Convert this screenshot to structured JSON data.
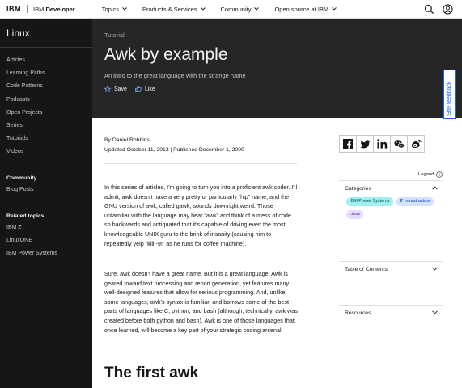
{
  "topnav": {
    "logo": "IBM",
    "brand_prefix": "IBM",
    "brand_name": "Developer",
    "items": [
      {
        "label": "Topics"
      },
      {
        "label": "Products & Services"
      },
      {
        "label": "Community"
      },
      {
        "label": "Open source at IBM"
      }
    ],
    "icons": [
      "search-icon",
      "user-icon"
    ]
  },
  "sidebar": {
    "title": "Linux",
    "items": [
      {
        "label": "Articles"
      },
      {
        "label": "Learning Paths"
      },
      {
        "label": "Code Patterns"
      },
      {
        "label": "Podcasts"
      },
      {
        "label": "Open Projects"
      },
      {
        "label": "Series"
      },
      {
        "label": "Tutorials"
      },
      {
        "label": "Videos"
      }
    ],
    "community_heading": "Community",
    "community_link": "Blog Posts",
    "related_heading": "Related topics",
    "related": [
      {
        "label": "IBM Z"
      },
      {
        "label": "LinuxONE"
      },
      {
        "label": "IBM Power Systems"
      }
    ]
  },
  "hero": {
    "kicker": "Tutorial",
    "title": "Awk by example",
    "subtitle": "An intro to the great language with the strange name",
    "save_label": "Save",
    "like_label": "Like"
  },
  "feedback_label": "Site feedback",
  "article": {
    "author": "By Daniel Robbins",
    "dates": "Updated October 11, 2013 | Published December 1, 2000",
    "para1": "In this series of articles, I’m going to turn you into a proficient awk coder. I’ll admit, awk doesn’t have a very pretty or particularly “hip” name, and the GNU version of awk, called gawk, sounds downright weird. Those unfamiliar with the language may hear “awk” and think of a mess of code so backwards and antiquated that it’s capable of driving even the most knowledgeable UNIX guru to the brink of insanity (causing him to repeatedly yelp “kill -9!” as he runs for coffee machine).",
    "para2": "Sure, awk doesn’t have a great name. But it is a great language. Awk is geared toward text processing and report generation, yet features many well-designed features that allow for serious programming. And, unlike some languages, awk’s syntax is familiar, and borrows some of the best parts of languages like C, python, and bash (although, technically, awk was created before both python and bash). Awk is one of those languages that, once learned, will become a key part of your strategic coding arsenal.",
    "heading": "The first awk"
  },
  "share_icons": [
    "facebook-icon",
    "twitter-icon",
    "linkedin-icon",
    "wechat-icon",
    "weibo-icon"
  ],
  "legend_label": "Legend",
  "right_panel": {
    "categories_label": "Categories",
    "tags": [
      {
        "label": "IBM Power Systems",
        "color": "#9ef0f0"
      },
      {
        "label": "IT Infrastructure",
        "color": "#d0e2ff"
      },
      {
        "label": "Linux",
        "color": "#e8daff"
      }
    ],
    "toc_label": "Table of Contents",
    "resources_label": "Resources"
  },
  "colors": {
    "sidebar_bg": "#161616",
    "hero_bg": "#262626",
    "accent": "#0f62fe"
  }
}
